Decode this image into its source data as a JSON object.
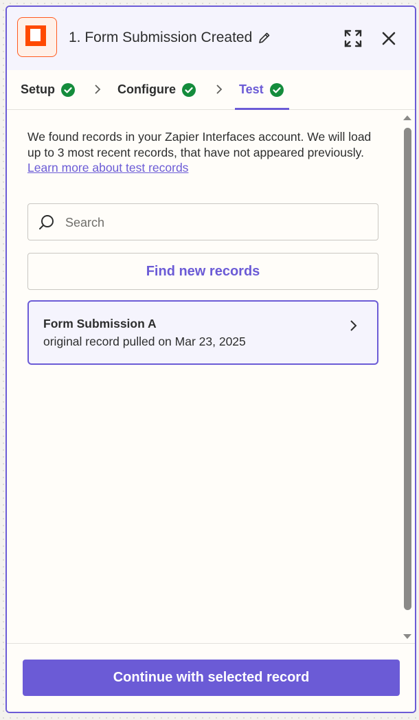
{
  "header": {
    "title": "1. Form Submission Created",
    "app_icon": "zapier-interfaces-icon",
    "actions": [
      "edit-pencil-icon",
      "expand-icon",
      "close-icon"
    ]
  },
  "tabs": [
    {
      "label": "Setup",
      "complete": true,
      "active": false
    },
    {
      "label": "Configure",
      "complete": true,
      "active": false
    },
    {
      "label": "Test",
      "complete": true,
      "active": true
    }
  ],
  "intro": {
    "text": "We found records in your Zapier Interfaces account. We will load up to 3 most recent records, that have not appeared previously.",
    "link": "Learn more about test records"
  },
  "search": {
    "placeholder": "Search",
    "value": ""
  },
  "find_button": "Find new records",
  "records": [
    {
      "title": "Form Submission A",
      "subtitle": "original record pulled on Mar 23, 2025",
      "selected": true
    }
  ],
  "footer": {
    "continue_button": "Continue with selected record"
  },
  "colors": {
    "accent": "#6b5bd6",
    "success": "#148c3c",
    "brand": "#ff4a00"
  }
}
